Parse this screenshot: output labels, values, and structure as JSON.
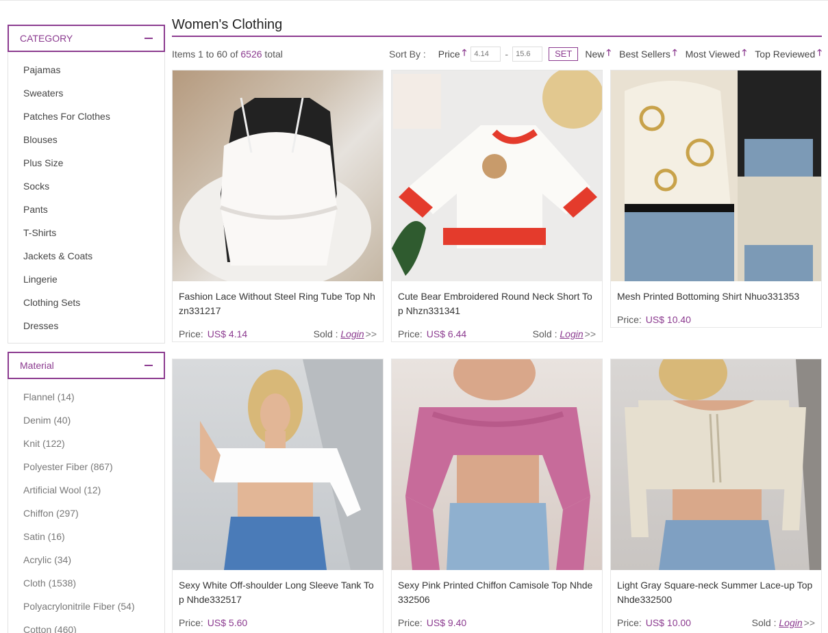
{
  "page_title": "Women's Clothing",
  "category_panel": {
    "title": "CATEGORY",
    "items": [
      "Pajamas",
      "Sweaters",
      "Patches For Clothes",
      "Blouses",
      "Plus Size",
      "Socks",
      "Pants",
      "T-Shirts",
      "Jackets & Coats",
      "Lingerie",
      "Clothing Sets",
      "Dresses"
    ]
  },
  "material_panel": {
    "title": "Material",
    "items": [
      "Flannel (14)",
      "Denim (40)",
      "Knit (122)",
      "Polyester Fiber (867)",
      "Artificial Wool (12)",
      "Chiffon (297)",
      "Satin (16)",
      "Acrylic (34)",
      "Cloth (1538)",
      "Polyacrylonitrile Fiber (54)",
      "Cotton (460)"
    ]
  },
  "toolbar": {
    "items_prefix": "Items 1 to 60 of ",
    "total_count": "6526",
    "items_suffix": " total",
    "sort_label": "Sort By :",
    "price_label": "Price",
    "price_min_placeholder": "4.14",
    "price_max_placeholder": "15.6",
    "dash": "-",
    "set_label": "SET",
    "new_label": "New",
    "best_sellers_label": "Best Sellers",
    "most_viewed_label": "Most Viewed",
    "top_reviewed_label": "Top Reviewed",
    "arrow": "🡑"
  },
  "products": [
    {
      "name": "Fashion Lace Without Steel Ring Tube Top Nhzn331217",
      "price_label": "Price:",
      "price": "US$ 4.14",
      "sold_label": "Sold :",
      "login": "Login",
      "chev": ">>"
    },
    {
      "name": "Cute Bear Embroidered Round Neck Short Top Nhzn331341",
      "price_label": "Price:",
      "price": "US$ 6.44",
      "sold_label": "Sold :",
      "login": "Login",
      "chev": ">>"
    },
    {
      "name": "Mesh Printed Bottoming Shirt Nhuo331353",
      "price_label": "Price:",
      "price": "US$ 10.40"
    },
    {
      "name": "Sexy White Off-shoulder Long Sleeve Tank Top Nhde332517",
      "price_label": "Price:",
      "price": "US$ 5.60"
    },
    {
      "name": "Sexy Pink Printed Chiffon Camisole Top Nhde332506",
      "price_label": "Price:",
      "price": "US$ 9.40"
    },
    {
      "name": "Light Gray Square-neck Summer Lace-up Top Nhde332500",
      "price_label": "Price:",
      "price": "US$ 10.00",
      "sold_label": "Sold :",
      "login": "Login",
      "chev": ">>"
    }
  ],
  "colors": {
    "accent": "#8b3a8f"
  }
}
